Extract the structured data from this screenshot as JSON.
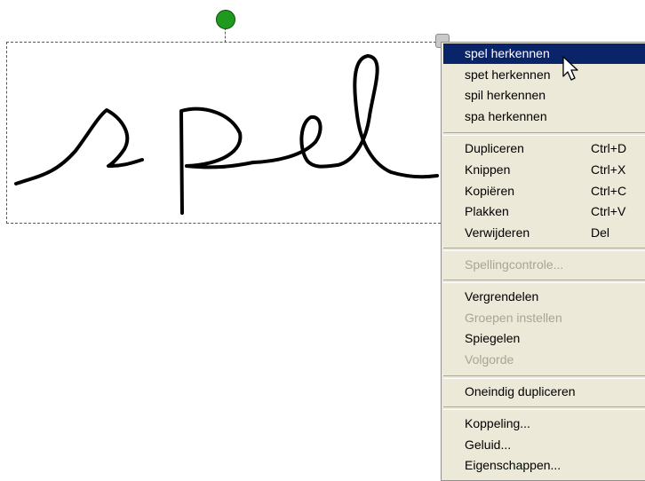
{
  "canvas": {
    "ink_text": "spel",
    "selection_color": "#3a4fd0",
    "rotate_handle_color": "#1f9a1f"
  },
  "context_menu": {
    "selected_color": "#0a246a",
    "recognition_suggestions": [
      {
        "label": "spel herkennen",
        "selected": true
      },
      {
        "label": "spet herkennen",
        "selected": false
      },
      {
        "label": "spil herkennen",
        "selected": false
      },
      {
        "label": "spa herkennen",
        "selected": false
      }
    ],
    "edit_items": [
      {
        "label": "Dupliceren",
        "shortcut": "Ctrl+D"
      },
      {
        "label": "Knippen",
        "shortcut": "Ctrl+X"
      },
      {
        "label": "Kopiëren",
        "shortcut": "Ctrl+C"
      },
      {
        "label": "Plakken",
        "shortcut": "Ctrl+V"
      },
      {
        "label": "Verwijderen",
        "shortcut": "Del"
      }
    ],
    "spelling": {
      "label": "Spellingcontrole...",
      "enabled": false
    },
    "submenu_items": [
      {
        "label": "Vergrendelen",
        "enabled": true
      },
      {
        "label": "Groepen instellen",
        "enabled": false
      },
      {
        "label": "Spiegelen",
        "enabled": true
      },
      {
        "label": "Volgorde",
        "enabled": false
      }
    ],
    "infinite_clone": {
      "label": "Oneindig dupliceren"
    },
    "other_items": [
      {
        "label": "Koppeling..."
      },
      {
        "label": "Geluid..."
      },
      {
        "label": "Eigenschappen..."
      }
    ]
  }
}
